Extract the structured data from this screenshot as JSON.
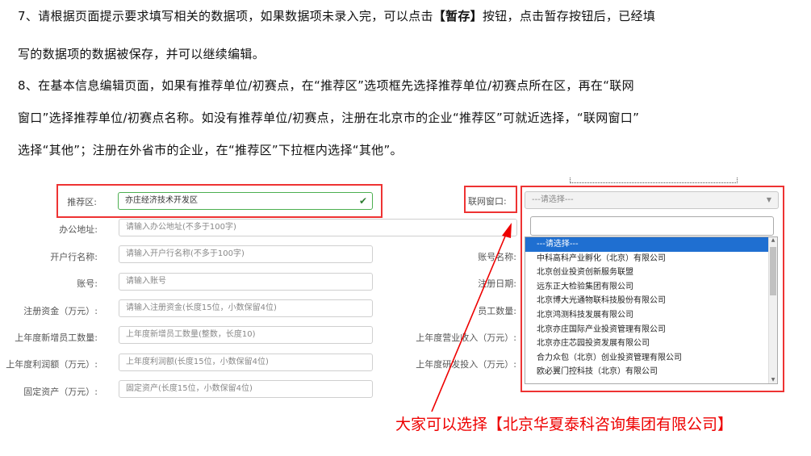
{
  "instructions": {
    "p7_line1_a": "7、请根据页面提示要求填写相关的数据项，如果数据项未录入完，可以点击",
    "p7_line1_b": "【暂存】",
    "p7_line1_c": "按钮，点击暂存按钮后，已经填",
    "p7_line2": "写的数据项的数据被保存，并可以继续编辑。",
    "p8_line1": "8、在基本信息编辑页面，如果有推荐单位/初赛点，在“推荐区”选项框先选择推荐单位/初赛点所在区，再在“联网",
    "p8_line2": "窗口”选择推荐单位/初赛点名称。如没有推荐单位/初赛点，注册在北京市的企业“推荐区”可就近选择，“联网窗口”",
    "p8_line3": "选择“其他”；注册在外省市的企业，在“推荐区”下拉框内选择“其他”。"
  },
  "form": {
    "recommend_area_label": "推荐区:",
    "recommend_area_value": "亦庄经济技术开发区",
    "network_window_label": "联网窗口:",
    "network_window_value": "---请选择---",
    "office_address_label": "办公地址:",
    "office_address_placeholder": "请输入办公地址(不多于100字)",
    "bank_name_label": "开户行名称:",
    "bank_name_placeholder": "请输入开户行名称(不多于100字)",
    "account_label": "账号:",
    "account_placeholder": "请输入账号",
    "reg_capital_label": "注册资金（万元）:",
    "reg_capital_placeholder": "请输入注册资金(长度15位，小数保留4位)",
    "new_staff_label": "上年度新增员工数量:",
    "new_staff_placeholder": "上年度新增员工数量(整数，长度10)",
    "profit_label": "上年度利润额（万元）:",
    "profit_placeholder": "上年度利润额(长度15位，小数保留4位)",
    "fixed_assets_label": "固定资产（万元）:",
    "fixed_assets_placeholder": "固定资产(长度15位，小数保留4位)",
    "right_account_name_label": "账号名称:",
    "right_reg_date_label": "注册日期:",
    "right_staff_label": "员工数量:",
    "right_revenue_label": "上年度营业收入（万元）:",
    "right_rd_label": "上年度研发投入（万元）:"
  },
  "dropdown": {
    "options": [
      "---请选择---",
      "中科高科产业孵化（北京）有限公司",
      "北京创业投资创新服务联盟",
      "远东正大检验集团有限公司",
      "北京博大光通物联科技股份有限公司",
      "北京鸿测科技发展有限公司",
      "北京亦庄国际产业投资管理有限公司",
      "北京亦庄芯园投资发展有限公司",
      "合力众包（北京）创业投资管理有限公司",
      "欧必翼门控科技（北京）有限公司"
    ],
    "selected_index": 0
  },
  "annotation": "大家可以选择【北京华夏泰科咨询集团有限公司】",
  "colors": {
    "highlight_border": "#e33333",
    "selected_option": "#1f6fd1",
    "annotation": "#ee0000"
  }
}
